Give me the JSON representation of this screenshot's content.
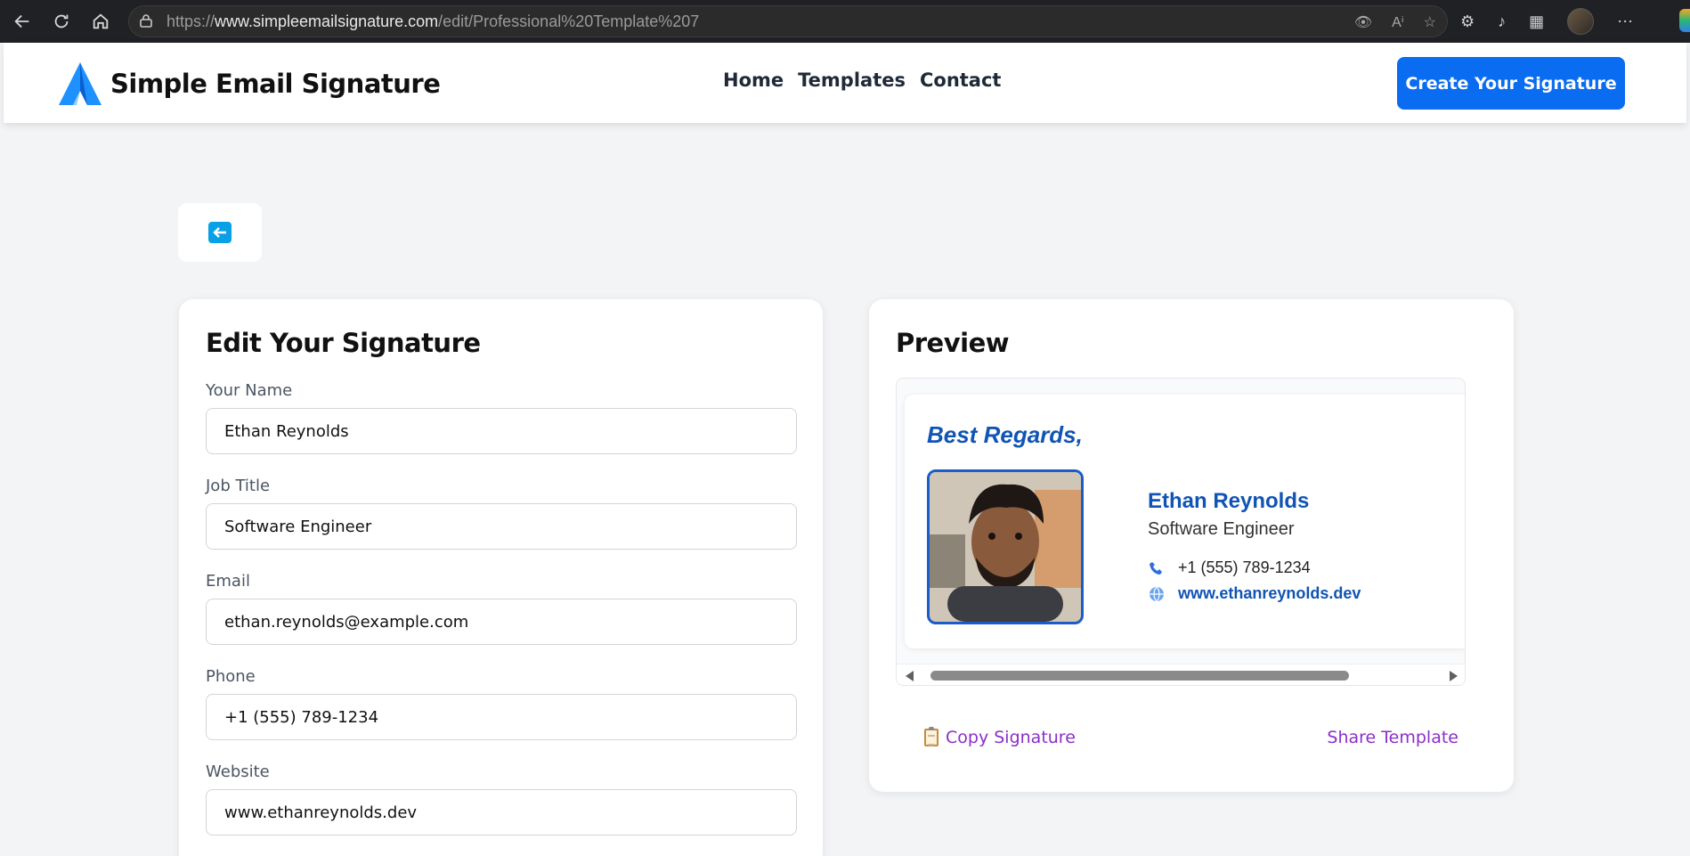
{
  "browser": {
    "url_prefix": "https://",
    "url_domain": "www.simpleemailsignature.com",
    "url_path": "/edit/Professional%20Template%207"
  },
  "header": {
    "brand": "Simple Email Signature",
    "nav": [
      "Home",
      "Templates",
      "Contact"
    ],
    "cta": "Create Your Signature"
  },
  "editor": {
    "title": "Edit Your Signature",
    "fields": [
      {
        "label": "Your Name",
        "value": "Ethan Reynolds"
      },
      {
        "label": "Job Title",
        "value": "Software Engineer"
      },
      {
        "label": "Email",
        "value": "ethan.reynolds@example.com"
      },
      {
        "label": "Phone",
        "value": "+1 (555) 789-1234"
      },
      {
        "label": "Website",
        "value": "www.ethanreynolds.dev"
      }
    ]
  },
  "preview": {
    "title": "Preview",
    "greeting": "Best Regards,",
    "name": "Ethan Reynolds",
    "job_title": "Software Engineer",
    "phone": "+1 (555) 789-1234",
    "website": "www.ethanreynolds.dev",
    "copy_label": "Copy Signature",
    "share_label": "Share Template"
  },
  "colors": {
    "brand_blue": "#0a6cf0",
    "signature_blue": "#1054b4",
    "action_purple": "#8b2fc9"
  }
}
